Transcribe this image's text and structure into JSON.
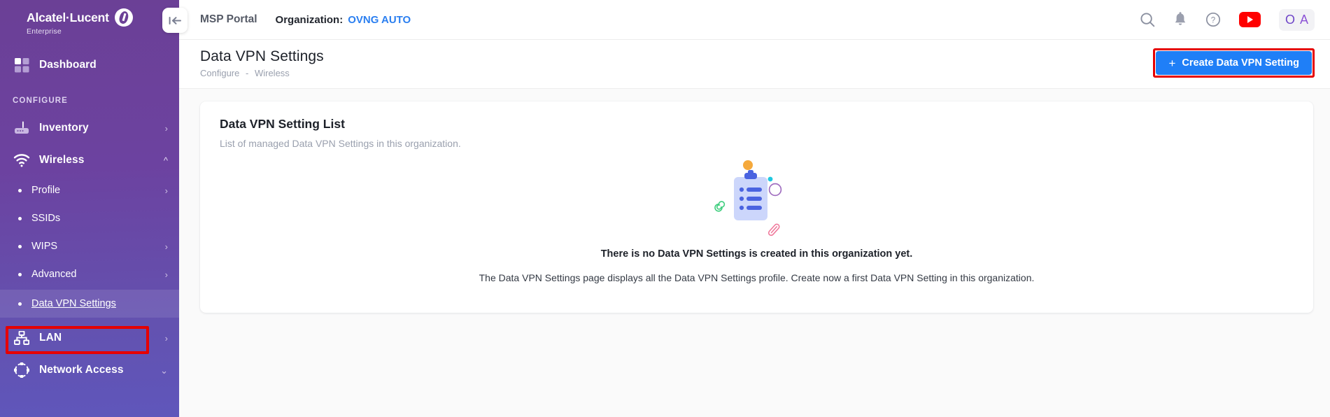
{
  "brand": {
    "name": "Alcatel·Lucent",
    "sub": "Enterprise",
    "logo_icon": "alcatel-lucent-spiral-logo"
  },
  "sidebar": {
    "dashboard": {
      "label": "Dashboard",
      "icon": "grid-dashboard-icon"
    },
    "section_title": "CONFIGURE",
    "items": [
      {
        "label": "Inventory",
        "icon": "router-icon",
        "chevron": "chevron-right-icon",
        "expanded": false
      },
      {
        "label": "Wireless",
        "icon": "wifi-icon",
        "chevron": "chevron-up-icon",
        "expanded": true
      }
    ],
    "wireless_children": [
      {
        "label": "Profile",
        "chevron": "chevron-right-icon",
        "active": false
      },
      {
        "label": "SSIDs",
        "chevron": "",
        "active": false
      },
      {
        "label": "WIPS",
        "chevron": "chevron-right-icon",
        "active": false
      },
      {
        "label": "Advanced",
        "chevron": "chevron-right-icon",
        "active": false
      },
      {
        "label": "Data VPN Settings",
        "chevron": "",
        "active": true
      }
    ],
    "tail_items": [
      {
        "label": "LAN",
        "icon": "lan-network-icon",
        "chevron": "chevron-right-icon"
      },
      {
        "label": "Network Access",
        "icon": "network-nodes-icon",
        "chevron": "chevron-down-icon"
      }
    ]
  },
  "topbar": {
    "msp_portal": "MSP Portal",
    "organization_label": "Organization:",
    "organization_value": "OVNG AUTO",
    "collapse_icon": "collapse-sidebar-arrow-icon",
    "icons": [
      {
        "name": "search-icon"
      },
      {
        "name": "notification-bell-icon"
      },
      {
        "name": "help-circle-icon"
      },
      {
        "name": "youtube-icon"
      }
    ],
    "avatar": {
      "initial_o": "O",
      "initial_a": "A"
    }
  },
  "page": {
    "title": "Data VPN Settings",
    "breadcrumb": {
      "parent": "Configure",
      "separator": "-",
      "child": "Wireless"
    },
    "create_button": {
      "label": "Create Data VPN Setting",
      "plus": "+",
      "icon": "plus-icon"
    }
  },
  "card": {
    "title": "Data VPN Setting List",
    "subtitle": "List of managed Data VPN Settings in this organization.",
    "empty_state": {
      "illustration": "clipboard-empty-illustration",
      "heading": "There is no Data VPN Settings is created in this organization yet.",
      "description": "The Data VPN Settings page displays all the Data VPN Settings profile. Create now a first Data VPN Setting in this organization."
    }
  },
  "colors": {
    "sidebar_top": "#6b4096",
    "sidebar_bottom": "#5f56bb",
    "accent_blue": "#1f7ff7",
    "org_blue": "#2b7ff0",
    "highlight_red": "#e60000",
    "youtube_red": "#ff0000"
  }
}
